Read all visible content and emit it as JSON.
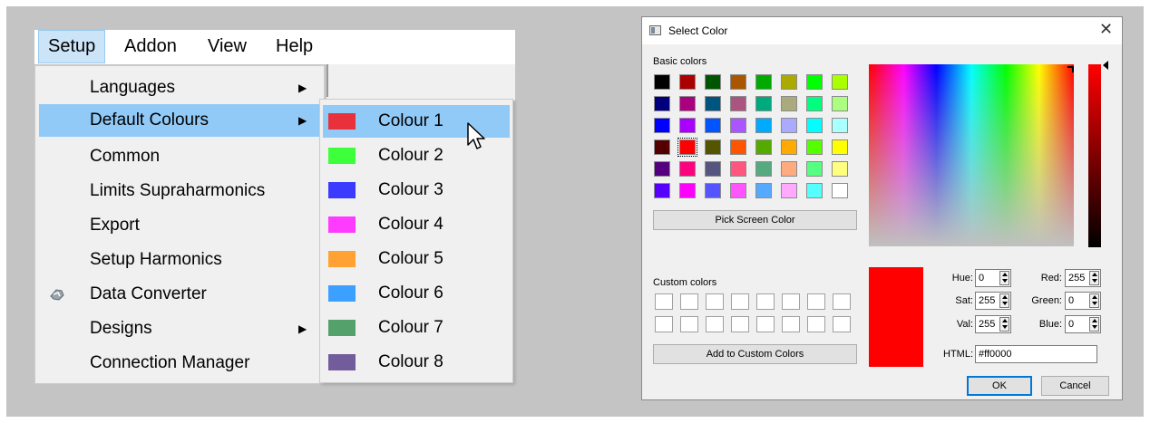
{
  "menubar": {
    "items": [
      "Setup",
      "Addon",
      "View",
      "Help"
    ]
  },
  "main_menu": {
    "items": [
      {
        "label": "Languages",
        "submenu": true
      },
      {
        "label": "Default Colours",
        "submenu": true
      },
      {
        "label": "Common",
        "submenu": false
      },
      {
        "label": "Limits Supraharmonics",
        "submenu": false
      },
      {
        "label": "Export",
        "submenu": false
      },
      {
        "label": "Setup Harmonics",
        "submenu": false
      },
      {
        "label": "Data Converter",
        "submenu": false,
        "icon": "data-converter-icon"
      },
      {
        "label": "Designs",
        "submenu": true
      },
      {
        "label": "Connection Manager",
        "submenu": false
      }
    ],
    "highlighted": "Default Colours"
  },
  "colour_submenu": {
    "items": [
      {
        "label": "Colour 1",
        "color": "#e8313a"
      },
      {
        "label": "Colour 2",
        "color": "#3dff3a"
      },
      {
        "label": "Colour 3",
        "color": "#3b3bff"
      },
      {
        "label": "Colour 4",
        "color": "#ff3bff"
      },
      {
        "label": "Colour 5",
        "color": "#ffa233"
      },
      {
        "label": "Colour 6",
        "color": "#3ba0ff"
      },
      {
        "label": "Colour 7",
        "color": "#55a16c"
      },
      {
        "label": "Colour 8",
        "color": "#735c9b"
      }
    ],
    "highlighted": "Colour 1"
  },
  "dialog": {
    "title": "Select Color",
    "basic_colors_label": "Basic colors",
    "basic_colors": [
      "#000000",
      "#aa0000",
      "#005500",
      "#aa5500",
      "#00aa00",
      "#aaaa00",
      "#00ff00",
      "#aaff00",
      "#00007f",
      "#aa007f",
      "#00557f",
      "#aa557f",
      "#00aa7f",
      "#aaaa7f",
      "#00ff7f",
      "#aaff7f",
      "#0000ff",
      "#aa00ff",
      "#0055ff",
      "#aa55ff",
      "#00aaff",
      "#aaaaff",
      "#00ffff",
      "#aaffff",
      "#550000",
      "#ff0000",
      "#555500",
      "#ff5500",
      "#55aa00",
      "#ffaa00",
      "#55ff00",
      "#ffff00",
      "#55007f",
      "#ff007f",
      "#55557f",
      "#ff557f",
      "#55aa7f",
      "#ffaa7f",
      "#55ff7f",
      "#ffff7f",
      "#5500ff",
      "#ff00ff",
      "#5555ff",
      "#ff55ff",
      "#55aaff",
      "#ffaaff",
      "#55ffff",
      "#ffffff"
    ],
    "selected_basic_index": 25,
    "pick_screen_label": "Pick Screen Color",
    "custom_colors_label": "Custom colors",
    "add_custom_label": "Add to Custom Colors",
    "fields": {
      "hue_label": "Hue:",
      "hue": "0",
      "sat_label": "Sat:",
      "sat": "255",
      "val_label": "Val:",
      "val": "255",
      "red_label": "Red:",
      "red": "255",
      "green_label": "Green:",
      "green": "0",
      "blue_label": "Blue:",
      "blue": "0",
      "html_label": "HTML:",
      "html": "#ff0000"
    },
    "current_color": "#ff0000",
    "ok_label": "OK",
    "cancel_label": "Cancel",
    "close_glyph": "✕"
  }
}
